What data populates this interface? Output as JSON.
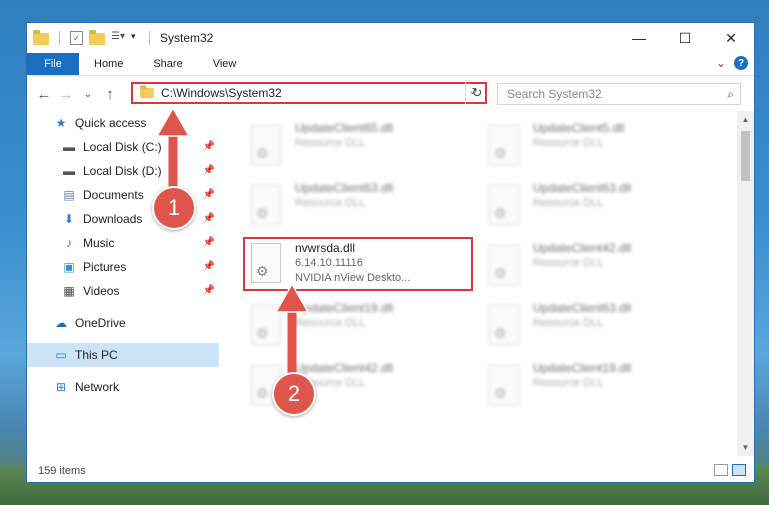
{
  "window": {
    "title": "System32",
    "controls": {
      "minimize": "—",
      "maximize": "☐",
      "close": "✕"
    }
  },
  "ribbon": {
    "tabs": [
      "File",
      "Home",
      "Share",
      "View"
    ],
    "expand": "⌄",
    "help": "?"
  },
  "nav": {
    "back": "←",
    "forward": "→",
    "recent": "⌄",
    "up": "↑",
    "address": "C:\\Windows\\System32",
    "address_chevron": "⌄",
    "refresh": "↻",
    "search_placeholder": "Search System32",
    "search_icon": "⌕"
  },
  "sidebar": {
    "quick_access": "Quick access",
    "items": [
      {
        "label": "Local Disk (C:)",
        "icon": "drive-icon"
      },
      {
        "label": "Local Disk (D:)",
        "icon": "drive-icon"
      },
      {
        "label": "Documents",
        "icon": "documents-icon"
      },
      {
        "label": "Downloads",
        "icon": "downloads-icon"
      },
      {
        "label": "Music",
        "icon": "music-icon"
      },
      {
        "label": "Pictures",
        "icon": "pictures-icon"
      },
      {
        "label": "Videos",
        "icon": "videos-icon"
      }
    ],
    "onedrive": "OneDrive",
    "this_pc": "This PC",
    "network": "Network"
  },
  "files": {
    "col1": [
      {
        "name": "UpdateClient65.dll",
        "sub": "Resource DLL"
      },
      {
        "name": "UpdateClient63.dll",
        "sub": "Resource DLL"
      },
      {
        "name": "nvwrsda.dll",
        "version": "6.14.10.11116",
        "desc": "NVIDIA nView Deskto..."
      },
      {
        "name": "UpdateClient19.dll",
        "sub": "Resource DLL"
      },
      {
        "name": "UpdateClient42.dll",
        "sub": "Resource DLL"
      }
    ],
    "col2": [
      {
        "name": "UpdateClient5.dll",
        "sub": "Resource DLL"
      },
      {
        "name": "UpdateClient63.dll",
        "sub": "Resource DLL"
      },
      {
        "name": "UpdateClient42.dll",
        "sub": "Resource DLL"
      },
      {
        "name": "UpdateClient63.dll",
        "sub": "Resource DLL"
      },
      {
        "name": "UpdateClient19.dll",
        "sub": "Resource DLL"
      }
    ]
  },
  "status": {
    "count": "159 items"
  },
  "callouts": {
    "one": "1",
    "two": "2"
  },
  "colors": {
    "accent": "#1a6fc4",
    "highlight": "#d9363e",
    "callout": "#e0554b"
  }
}
